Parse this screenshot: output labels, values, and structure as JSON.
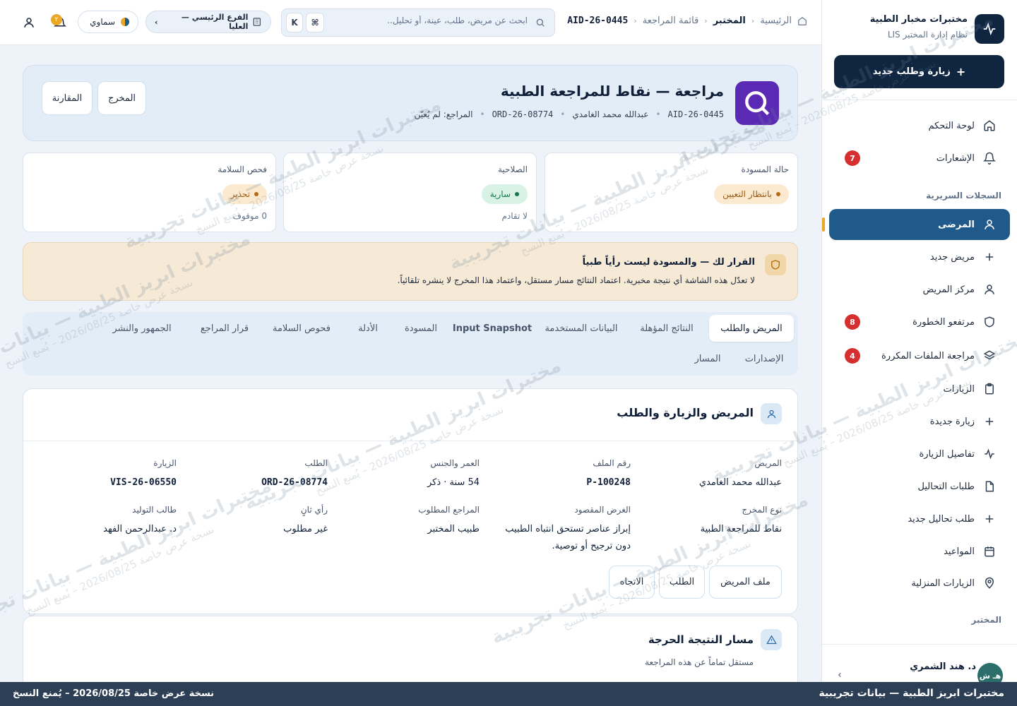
{
  "brand": {
    "name": "مختبرات مخبار الطبية",
    "subtitle": "نظام إدارة المختبر LIS"
  },
  "sidebar": {
    "new_visit_label": "زيارة وطلب جديد",
    "items": [
      {
        "label": "لوحة التحكم",
        "icon": "home-icon"
      },
      {
        "label": "الإشعارات",
        "icon": "bell-icon",
        "badge": "7"
      },
      {
        "label": "المرضى",
        "icon": "user-icon",
        "active": true
      },
      {
        "label": "مريض جديد",
        "icon": "plus-icon"
      },
      {
        "label": "مركز المريض",
        "icon": "user-icon"
      },
      {
        "label": "مرتفعو الخطورة",
        "icon": "shield-icon",
        "badge": "8"
      },
      {
        "label": "مراجعة الملفات المكررة",
        "icon": "layers-icon",
        "badge": "4"
      },
      {
        "label": "الزيارات",
        "icon": "clipboard-icon"
      },
      {
        "label": "زيارة جديدة",
        "icon": "plus-icon"
      },
      {
        "label": "تفاصيل الزيارة",
        "icon": "activity-icon"
      },
      {
        "label": "طلبات التحاليل",
        "icon": "file-icon"
      },
      {
        "label": "طلب تحاليل جديد",
        "icon": "plus-icon"
      },
      {
        "label": "المواعيد",
        "icon": "calendar-icon"
      },
      {
        "label": "الزيارات المنزلية",
        "icon": "map-pin-icon"
      }
    ],
    "section_records": "السجلات السريرية",
    "section_lab": "المختبر",
    "user": {
      "name": "د. هند الشمري",
      "initials": "هـ ش"
    }
  },
  "topbar": {
    "breadcrumb": [
      "الرئيسية",
      "المختبر",
      "قائمة المراجعة",
      "AID-26-0445"
    ],
    "search_placeholder": "ابحث عن مريض، طلب، عينة، أو تحليل...",
    "shortcut_1": "⌘",
    "shortcut_2": "K",
    "branch": "الفرع الرئيسي — العليا",
    "theme": "سماوي",
    "notif_count": "٢"
  },
  "hero": {
    "title": "مراجعة — نقاط للمراجعة الطبية",
    "aid": "AID-26-0445",
    "patient": "عبدالله محمد الغامدي",
    "order": "ORD-26-08774",
    "reviewer": "المراجع: لم يُعيّن",
    "btn_output": "المخرج",
    "btn_compare": "المقارنة"
  },
  "status": {
    "draft": {
      "label": "حالة المسودة",
      "value": "بانتظار التعيين"
    },
    "validity": {
      "label": "الصلاحية",
      "value": "سارية",
      "sub": "لا تقادم"
    },
    "safety": {
      "label": "فحص السلامة",
      "value": "تحذير",
      "sub": "0 موقوف"
    }
  },
  "warning": {
    "title": "القرار لك — والمسودة ليست رأياً طبياً",
    "body": "لا تعدّل هذه الشاشة أي نتيجة مخبرية. اعتماد النتائج مسار مستقل، واعتماد هذا المخرج لا ينشره تلقائياً."
  },
  "tabs": {
    "row1": [
      "المريض والطلب",
      "النتائج المؤهلة",
      "البيانات المستخدمة",
      "Input Snapshot",
      "المسودة",
      "الأدلة",
      "فحوص السلامة",
      "قرار المراجع",
      "الجمهور والنشر"
    ],
    "row2": [
      "الإصدارات",
      "المسار"
    ]
  },
  "panel": {
    "title": "المريض والزيارة والطلب",
    "fields": [
      {
        "label": "المريض",
        "value": "عبدالله محمد الغامدي"
      },
      {
        "label": "رقم الملف",
        "value": "P-100248"
      },
      {
        "label": "العمر والجنس",
        "value": "54 سنة · ذكر"
      },
      {
        "label": "الطلب",
        "value": "ORD-26-08774"
      },
      {
        "label": "الزيارة",
        "value": "VIS-26-06550"
      },
      {
        "label": "نوع المخرج",
        "value": "نقاط للمراجعة الطبية"
      },
      {
        "label": "الغرض المقصود",
        "value": "إبراز عناصر تستحق انتباه الطبيب دون ترجيح أو توصية."
      },
      {
        "label": "المراجع المطلوب",
        "value": "طبيب المختبر"
      },
      {
        "label": "رأي ثانٍ",
        "value": "غير مطلوب"
      },
      {
        "label": "طالب التوليد",
        "value": "د. عبدالرحمن الفهد"
      }
    ],
    "btn_patient": "ملف المريض",
    "btn_order": "الطلب",
    "btn_trend": "الاتجاه"
  },
  "panel2": {
    "title": "مسار النتيجة الحرجة",
    "subtitle": "مستقل تماماً عن هذه المراجعة"
  },
  "footer": {
    "left": "نسخة عرض خاصة 2026/08/25 – يُمنع النسخ",
    "right": "مختبرات ابريز الطبية — بيانات تجريبية"
  },
  "watermark": {
    "line1": "مختبرات ابريز الطبية — بيانات تجريبية",
    "line2": "نسخة عرض خاصة 2026/08/25 – يُمنع النسخ"
  },
  "colors": {
    "primary": "#0f2540",
    "active_nav": "#1f5a8a",
    "badge": "#d62f2f",
    "warning_bg": "#f6e9d6",
    "accent": "#5b2ab5"
  }
}
